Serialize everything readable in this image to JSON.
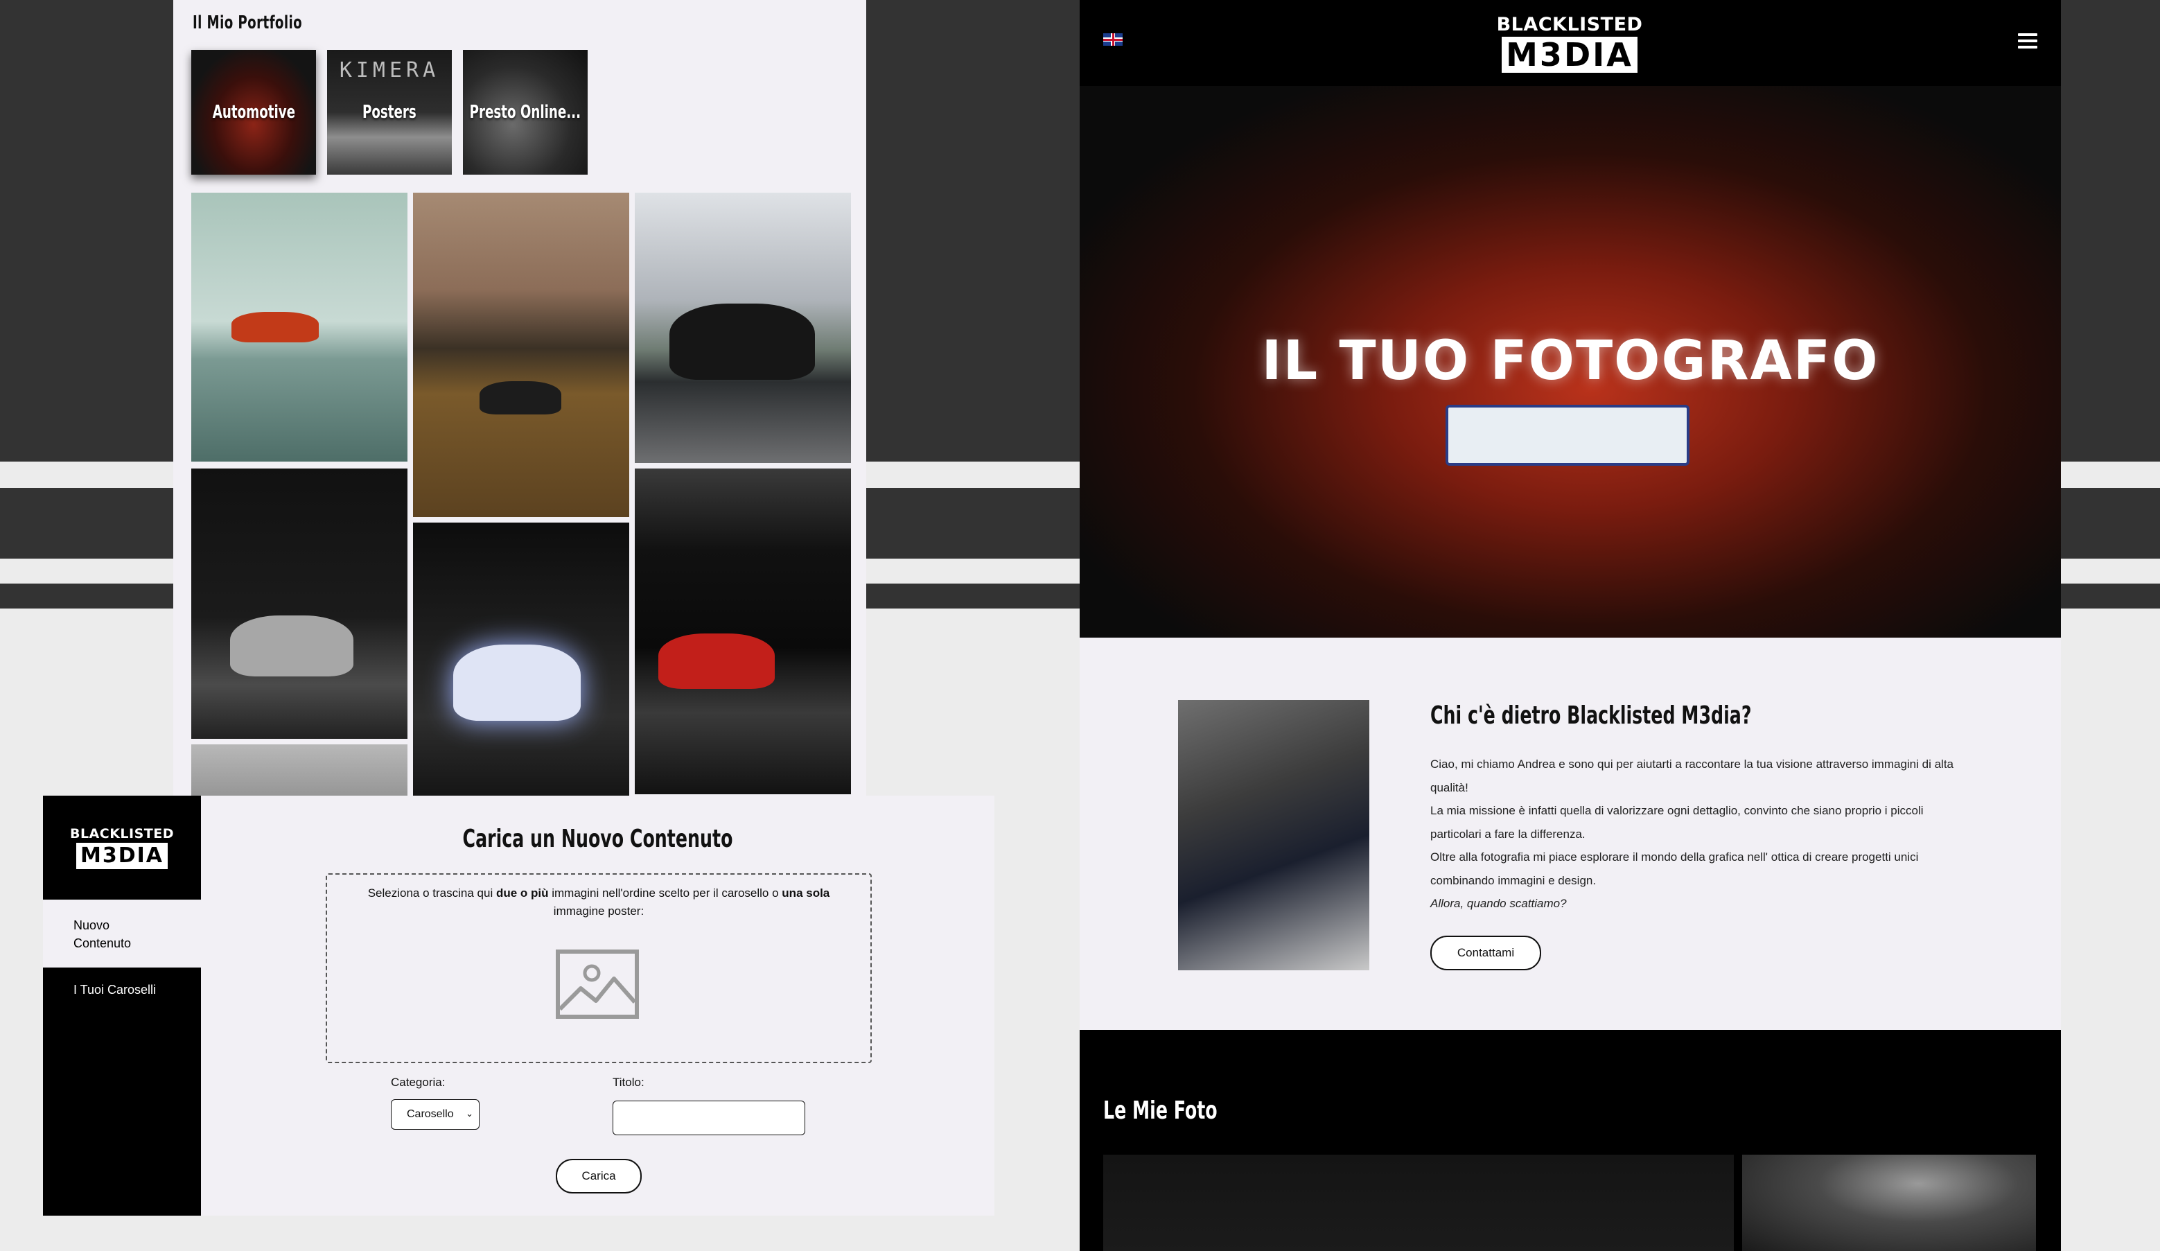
{
  "portfolio": {
    "title": "Il Mio Portfolio",
    "categories": [
      {
        "label": "Automotive"
      },
      {
        "label": "Posters",
        "brand": "KIMERA"
      },
      {
        "label": "Presto Online..."
      }
    ]
  },
  "admin": {
    "logo_top": "BLACKLISTED",
    "logo_bottom": "M3DIA",
    "menu": {
      "new_content": "Nuovo Contenuto",
      "carousels": "I Tuoi Caroselli"
    },
    "title": "Carica un Nuovo Contenuto",
    "dropzone": {
      "text_1": "Seleziona o trascina qui ",
      "text_bold_1": "due o più",
      "text_2": " immagini nell'ordine scelto per il carosello o ",
      "text_bold_2": "una sola",
      "text_3": " immagine poster:"
    },
    "category_label": "Categoria:",
    "category_value": "Carosello",
    "title_label": "Titolo:",
    "title_value": "",
    "upload_button": "Carica"
  },
  "site": {
    "logo_top": "BLACKLISTED",
    "logo_bottom": "M3DIA",
    "hero_title": "IL TUO FOTOGRAFO",
    "about": {
      "title": "Chi c'è dietro Blacklisted M3dia?",
      "p1": "Ciao, mi chiamo Andrea e sono qui per aiutarti a raccontare la tua visione attraverso immagini di alta qualità!",
      "p2": "La mia missione è infatti quella di valorizzare ogni dettaglio, convinto che siano proprio i piccoli particolari a fare la differenza.",
      "p3": "Oltre alla fotografia mi piace esplorare il mondo della grafica nell' ottica di creare progetti unici combinando immagini e design.",
      "p4": "Allora, quando scattiamo?",
      "button": "Contattami"
    },
    "photos_title": "Le Mie Foto"
  }
}
